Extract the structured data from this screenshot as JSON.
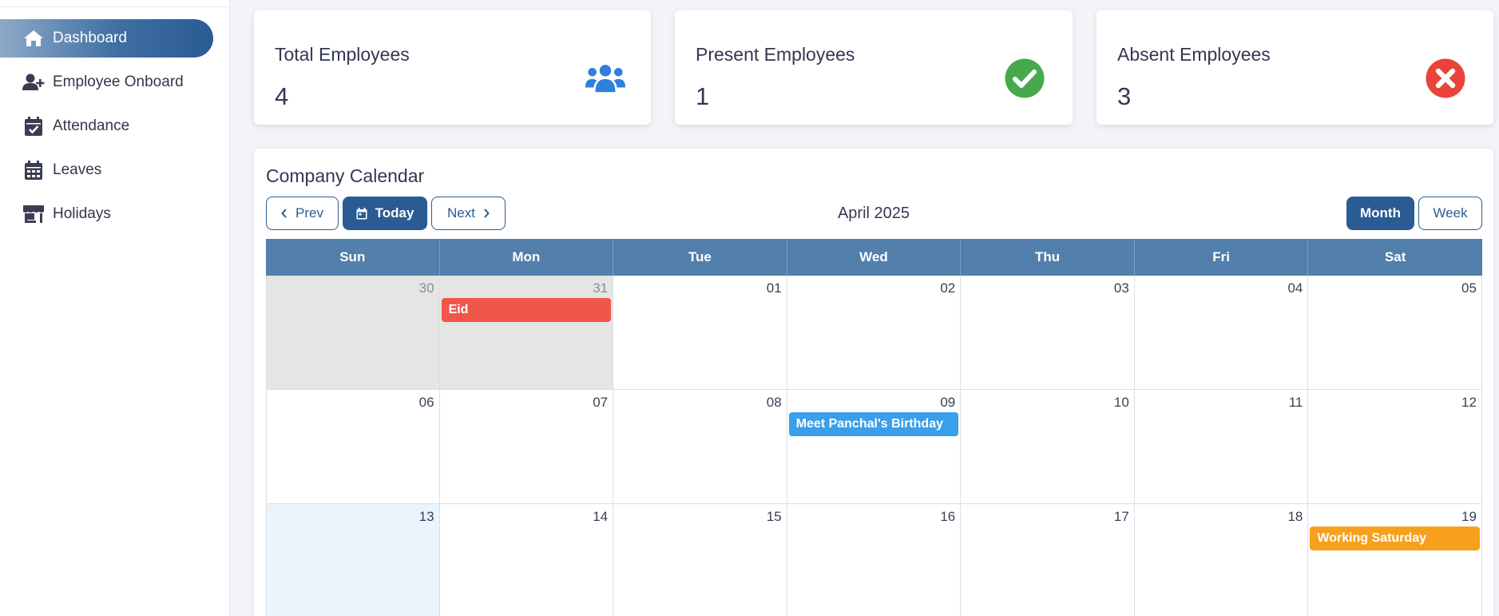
{
  "sidebar": {
    "items": [
      {
        "label": "Dashboard",
        "icon": "home-icon",
        "active": true
      },
      {
        "label": "Employee Onboard",
        "icon": "user-plus-icon"
      },
      {
        "label": "Attendance",
        "icon": "calendar-check-icon"
      },
      {
        "label": "Leaves",
        "icon": "calendar-grid-icon"
      },
      {
        "label": "Holidays",
        "icon": "store-icon"
      }
    ]
  },
  "stats": [
    {
      "title": "Total Employees",
      "value": "4",
      "icon": "users-icon",
      "color": "#2f7fdc"
    },
    {
      "title": "Present Employees",
      "value": "1",
      "icon": "check-circle-icon",
      "color": "#48a84e"
    },
    {
      "title": "Absent Employees",
      "value": "3",
      "icon": "x-circle-icon",
      "color": "#e9433a"
    }
  ],
  "calendar": {
    "title": "Company Calendar",
    "prev_label": "Prev",
    "today_label": "Today",
    "next_label": "Next",
    "month_label": "April 2025",
    "view_month_label": "Month",
    "view_week_label": "Week",
    "days": [
      "Sun",
      "Mon",
      "Tue",
      "Wed",
      "Thu",
      "Fri",
      "Sat"
    ],
    "weeks": [
      [
        "30",
        "31",
        "01",
        "02",
        "03",
        "04",
        "05"
      ],
      [
        "06",
        "07",
        "08",
        "09",
        "10",
        "11",
        "12"
      ],
      [
        "13",
        "14",
        "15",
        "16",
        "17",
        "18",
        "19"
      ]
    ],
    "events": {
      "eid": "Eid",
      "birthday": "Meet Panchal's Birthday",
      "working_saturday": "Working Saturday"
    },
    "colors": {
      "eid": "#f0574a",
      "birthday": "#3a9fea",
      "working_saturday": "#f7a01e",
      "header": "#527fab",
      "accent": "#2a5b93"
    }
  }
}
